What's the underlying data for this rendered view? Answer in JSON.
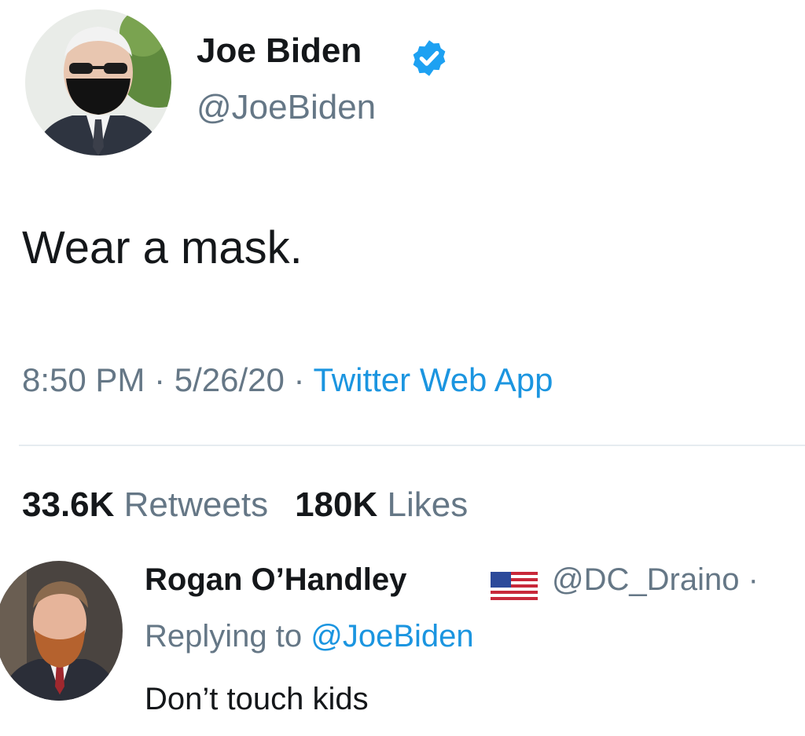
{
  "tweet": {
    "author_name": "Joe Biden",
    "author_handle": "@JoeBiden",
    "text": "Wear a mask.",
    "time": "8:50 PM",
    "separator1": " · ",
    "date": "5/26/20",
    "separator2": " · ",
    "source": "Twitter Web App",
    "retweets_count": "33.6K",
    "retweets_label": "Retweets",
    "likes_count": "180K",
    "likes_label": "Likes"
  },
  "reply": {
    "author_name": "Rogan O’Handley",
    "author_handle": "@DC_Draino ·",
    "replying_prefix": "Replying to ",
    "replying_handle": "@JoeBiden",
    "text": "Don’t touch kids"
  },
  "colors": {
    "accent": "#1b95e0",
    "secondary_text": "#657786",
    "primary_text": "#14171a"
  },
  "icons": {
    "verified": "verified-badge-icon",
    "flag": "us-flag-icon"
  }
}
